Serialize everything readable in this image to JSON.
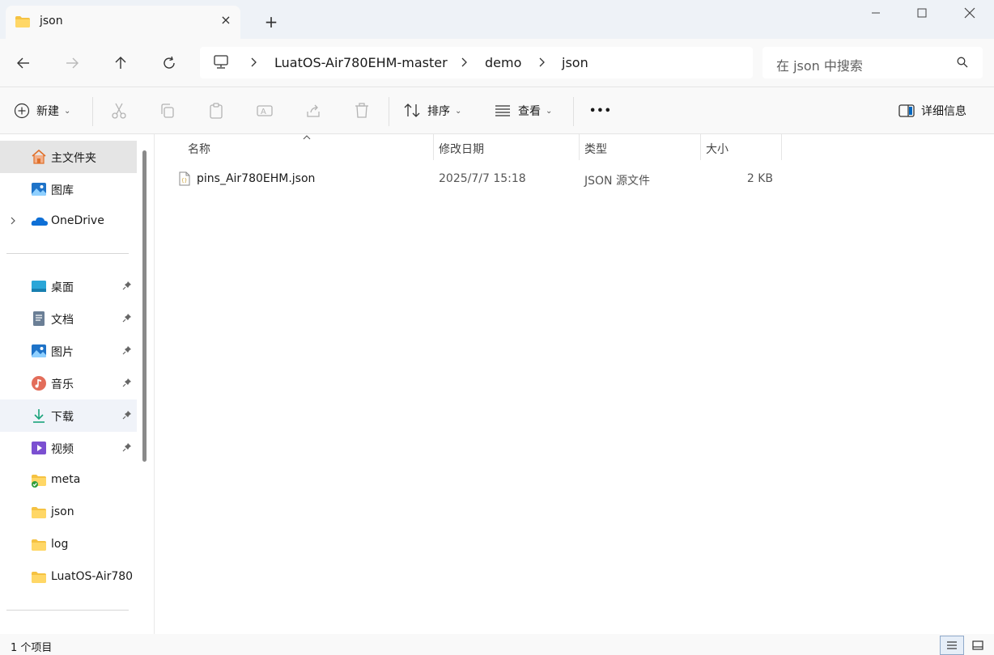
{
  "window": {
    "tab_title": "json",
    "new_tab": "+",
    "tab_close": "×"
  },
  "address": {
    "crumbs": [
      "LuatOS-Air780EHM-master",
      "demo",
      "json"
    ]
  },
  "search": {
    "placeholder": "在 json 中搜索"
  },
  "toolbar": {
    "new_label": "新建",
    "sort_label": "排序",
    "view_label": "查看",
    "more_label": "•••",
    "details_label": "详细信息"
  },
  "sidebar": {
    "top": [
      {
        "label": "主文件夹",
        "icon": "home-icon"
      },
      {
        "label": "图库",
        "icon": "gallery-icon"
      },
      {
        "label": "OneDrive",
        "icon": "onedrive-icon"
      }
    ],
    "quick": [
      {
        "label": "桌面",
        "icon": "desktop-icon"
      },
      {
        "label": "文档",
        "icon": "document-icon"
      },
      {
        "label": "图片",
        "icon": "pictures-icon"
      },
      {
        "label": "音乐",
        "icon": "music-icon"
      },
      {
        "label": "下载",
        "icon": "download-icon"
      },
      {
        "label": "视频",
        "icon": "video-icon"
      },
      {
        "label": "meta",
        "icon": "folder-icon"
      },
      {
        "label": "json",
        "icon": "folder-icon"
      },
      {
        "label": "log",
        "icon": "folder-icon"
      },
      {
        "label": "LuatOS-Air780",
        "icon": "folder-icon"
      }
    ]
  },
  "columns": {
    "name": "名称",
    "modified": "修改日期",
    "type": "类型",
    "size": "大小"
  },
  "files": [
    {
      "name": "pins_Air780EHM.json",
      "modified": "2025/7/7 15:18",
      "type": "JSON 源文件",
      "size": "2 KB"
    }
  ],
  "status": {
    "count": "1 个项目"
  },
  "colors": {
    "accent": "#0067c0",
    "folder": "#f5c242",
    "selected_bg": "#e5e5e5"
  }
}
